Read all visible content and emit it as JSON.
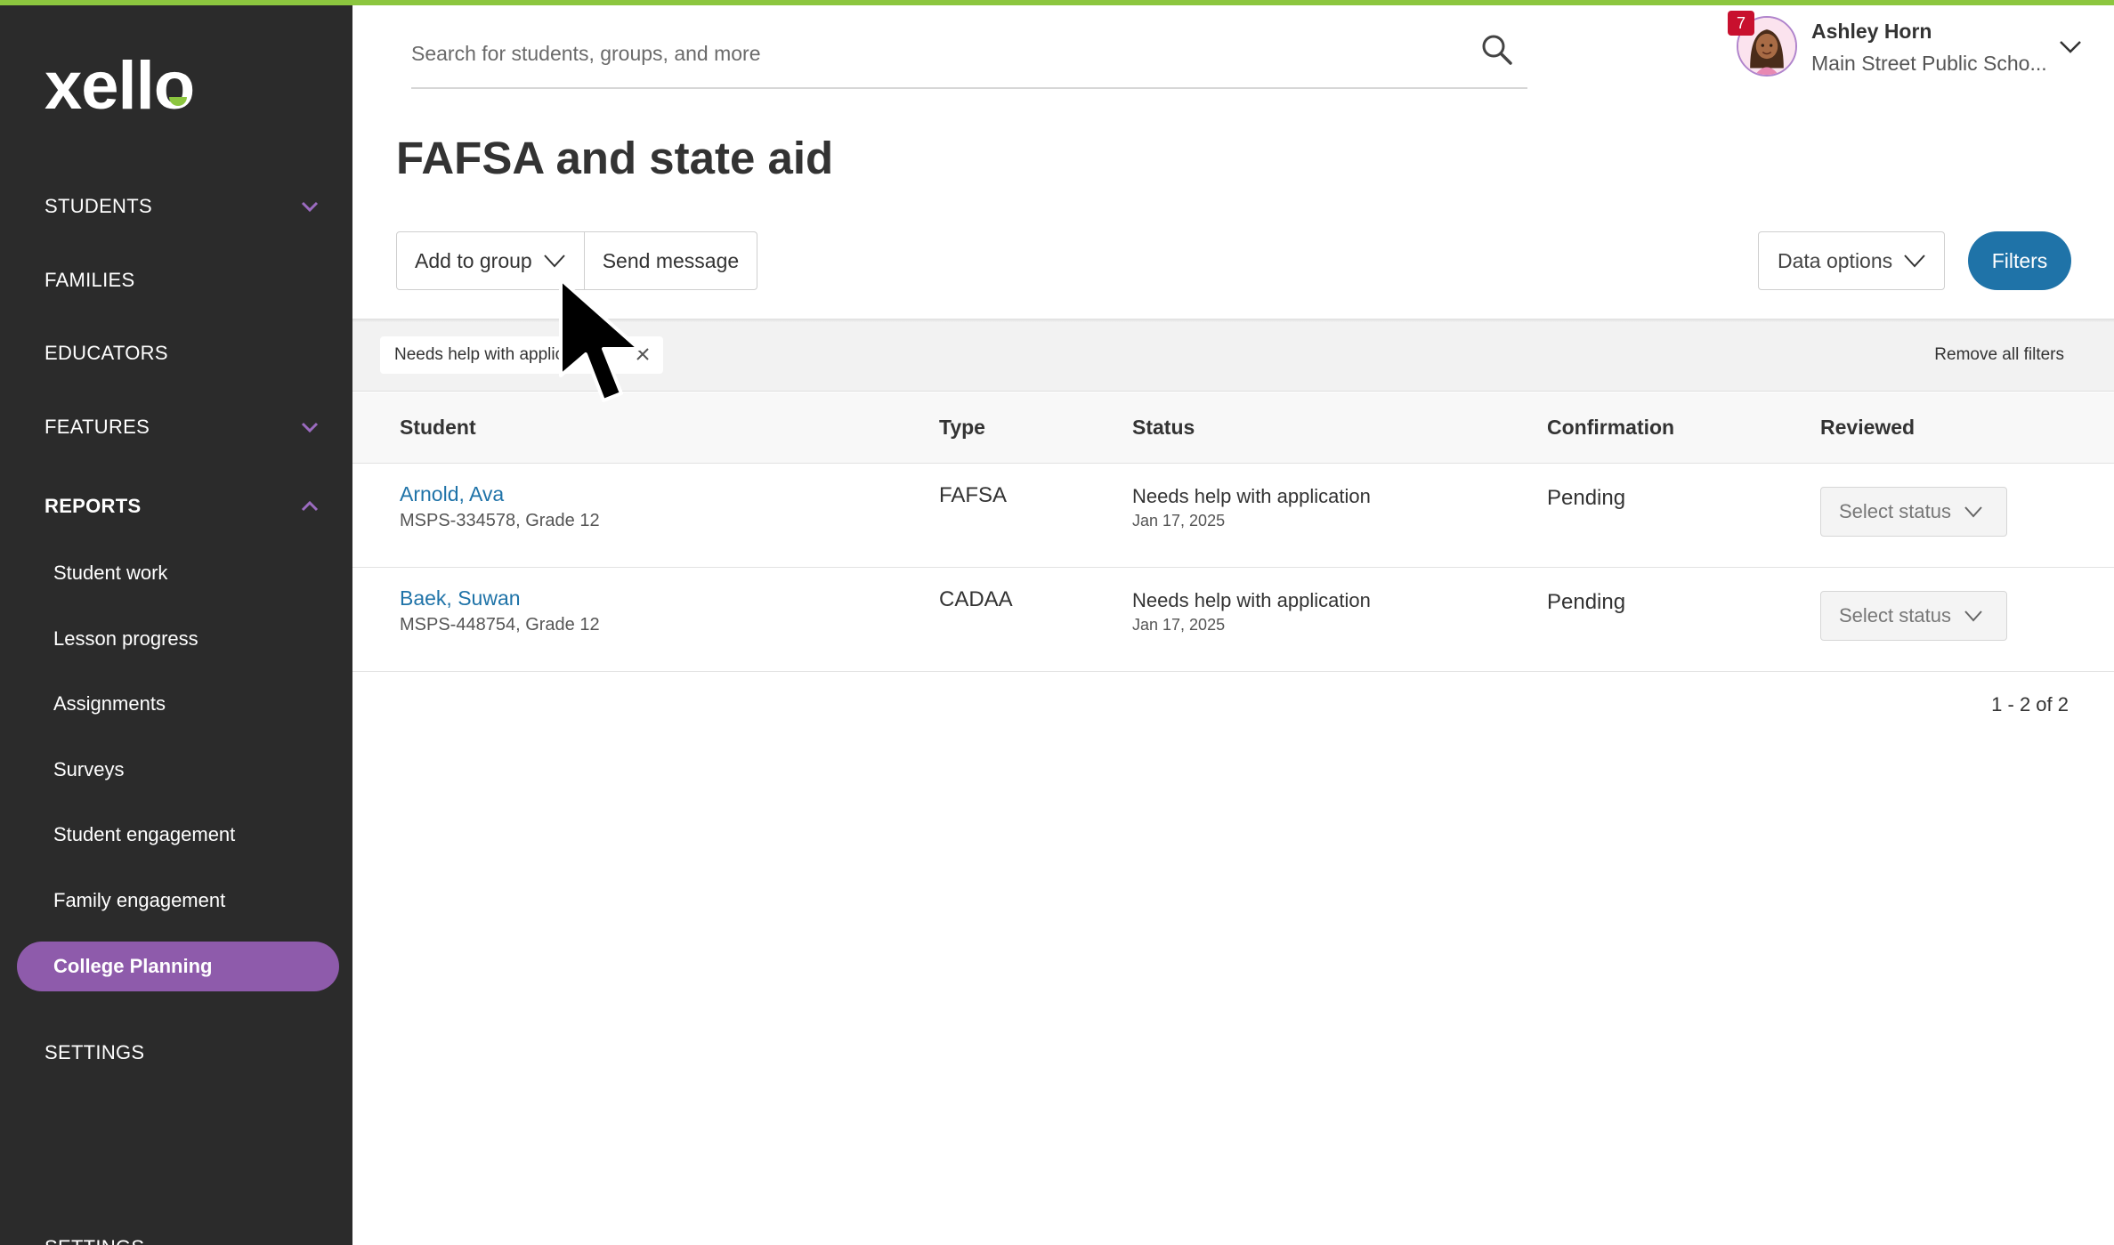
{
  "brand": {
    "logo_text": "xello",
    "accent": "#8cc63f",
    "purple": "#8e5bab",
    "blue": "#1f73a8"
  },
  "sidebar": {
    "items": [
      {
        "label": "STUDENTS",
        "expandable": true,
        "expanded": false
      },
      {
        "label": "FAMILIES"
      },
      {
        "label": "EDUCATORS"
      },
      {
        "label": "FEATURES",
        "expandable": true,
        "expanded": false
      },
      {
        "label": "REPORTS",
        "expandable": true,
        "expanded": true
      },
      {
        "label": "SETTINGS"
      },
      {
        "label": "SETTINGS"
      }
    ],
    "report_items": [
      {
        "label": "Student work"
      },
      {
        "label": "Lesson progress"
      },
      {
        "label": "Assignments"
      },
      {
        "label": "Surveys"
      },
      {
        "label": "Student engagement"
      },
      {
        "label": "Family engagement"
      },
      {
        "label": "College Planning",
        "active": true
      }
    ]
  },
  "search": {
    "placeholder": "Search for students, groups, and more",
    "value": "",
    "icon": "search-icon"
  },
  "user": {
    "name": "Ashley Horn",
    "school": "Main Street Public Scho...",
    "notification_count": "7",
    "icon": "avatar"
  },
  "page": {
    "title": "FAFSA and state aid"
  },
  "toolbar": {
    "add_to_group": "Add to group",
    "send_message": "Send message",
    "data_options": "Data options",
    "filters": "Filters"
  },
  "filter_bar": {
    "chip_label": "Needs help with applica",
    "remove_all": "Remove all filters"
  },
  "table": {
    "headers": [
      "Student",
      "Type",
      "Status",
      "Confirmation",
      "Reviewed"
    ],
    "rows": [
      {
        "name": "Arnold, Ava",
        "id": "MSPS-334578, Grade 12",
        "type": "FAFSA",
        "status": "Needs help with application",
        "date": "Jan 17, 2025",
        "confirmation": "Pending",
        "reviewed": "Select status"
      },
      {
        "name": "Baek, Suwan",
        "id": "MSPS-448754, Grade 12",
        "type": "CADAA",
        "status": "Needs help with application",
        "date": "Jan 17, 2025",
        "confirmation": "Pending",
        "reviewed": "Select status"
      }
    ],
    "pagination": "1 - 2 of 2"
  }
}
